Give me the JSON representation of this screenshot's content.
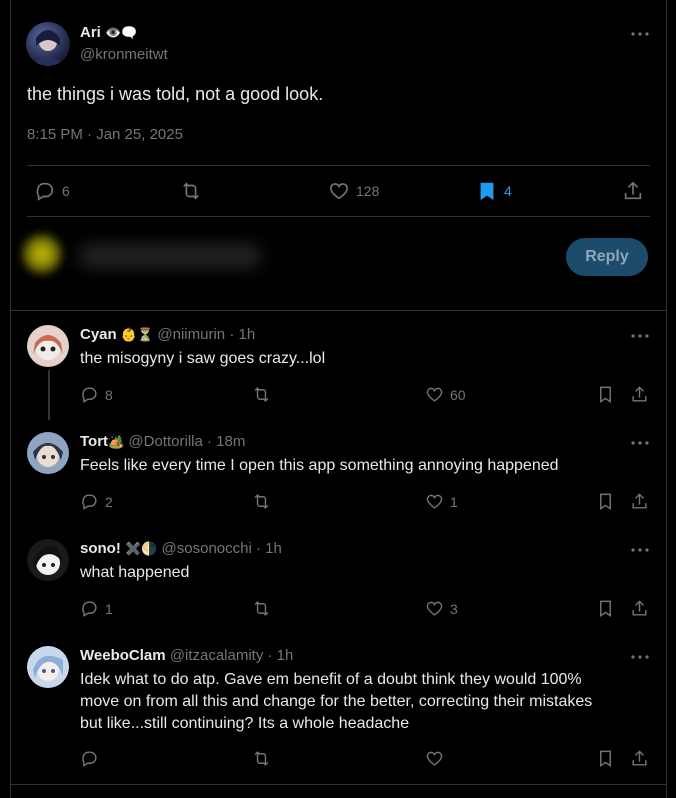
{
  "main_post": {
    "display_name": "Ari",
    "name_emoji": "👁️🗨️",
    "handle": "@kronmeitwt",
    "text": "the things i was told, not a good look.",
    "timestamp": "8:15 PM · Jan 25, 2025",
    "stats": {
      "replies": "6",
      "reposts": "",
      "likes": "128",
      "bookmarks": "4"
    },
    "colors": {
      "bookmark_active": "#1d9bf0"
    }
  },
  "compose": {
    "reply_label": "Reply",
    "reply_button_color": "#1d4b6b"
  },
  "replies": [
    {
      "display_name": "Cyan",
      "name_emoji": "👶⏳",
      "handle": "@niimurin",
      "time": "· 1h",
      "text": [
        "the misogyny i saw goes crazy...lol"
      ],
      "replies": "8",
      "likes": "60"
    },
    {
      "display_name": "Tort",
      "name_emoji": "🏕️",
      "handle": "@Dottorilla",
      "time": "· 18m",
      "text": [
        "Feels like every time I open this app something annoying happened"
      ],
      "replies": "2",
      "likes": "1"
    },
    {
      "display_name": "sono!",
      "name_emoji": "✖️🌗",
      "handle": "@sosonocchi",
      "time": "· 1h",
      "text": [
        "what happened"
      ],
      "replies": "1",
      "likes": "3"
    },
    {
      "display_name": "WeeboClam",
      "name_emoji": "",
      "handle": "@itzacalamity",
      "time": "· 1h",
      "text": [
        "Idek what to do atp. Gave em benefit of a doubt think they would 100%",
        "move on from all this and change for the better, correcting their mistakes",
        "but like...still continuing? Its a whole headache"
      ],
      "replies": "",
      "likes": ""
    }
  ]
}
